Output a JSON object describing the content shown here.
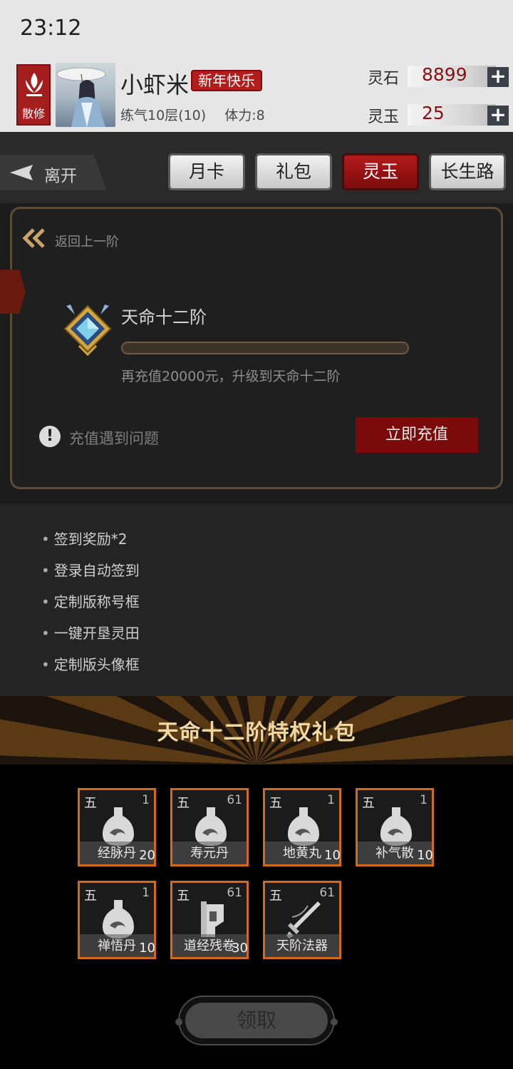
{
  "status_bar": {
    "time": "23:12"
  },
  "player": {
    "sect_label": "散修",
    "name": "小虾米",
    "title_badge": "新年快乐",
    "realm": "练气10层(10)",
    "stamina": "体力:8"
  },
  "resources": [
    {
      "label": "灵石",
      "value": "8899"
    },
    {
      "label": "灵玉",
      "value": "25"
    }
  ],
  "nav": {
    "leave_label": "离开",
    "tabs": [
      {
        "label": "月卡",
        "active": false
      },
      {
        "label": "礼包",
        "active": false
      },
      {
        "label": "灵玉",
        "active": true
      },
      {
        "label": "长生路",
        "active": false
      }
    ]
  },
  "panel": {
    "back_label": "返回上一阶",
    "rank_name": "天命十二阶",
    "progress": 0.0,
    "recharge_hint": "再充值20000元，升级到天命十二阶",
    "help_label": "充值遇到问题",
    "recharge_button": "立即充值"
  },
  "perks": [
    "签到奖励*2",
    "登录自动签到",
    "定制版称号框",
    "一键开垦灵田",
    "定制版头像框"
  ],
  "gift": {
    "title": "天命十二阶特权礼包",
    "items": [
      {
        "grade": "五",
        "level": "1",
        "name": "经脉丹",
        "qty": "20",
        "icon": "potion-icon"
      },
      {
        "grade": "五",
        "level": "61",
        "name": "寿元丹",
        "qty": "",
        "icon": "potion-icon"
      },
      {
        "grade": "五",
        "level": "1",
        "name": "地黄丸",
        "qty": "10",
        "icon": "potion-icon"
      },
      {
        "grade": "五",
        "level": "1",
        "name": "补气散",
        "qty": "10",
        "icon": "potion-icon"
      },
      {
        "grade": "五",
        "level": "1",
        "name": "禅悟丹",
        "qty": "10",
        "icon": "potion-icon"
      },
      {
        "grade": "五",
        "level": "61",
        "name": "道经残卷",
        "qty": "30",
        "icon": "scroll-icon"
      },
      {
        "grade": "五",
        "level": "61",
        "name": "天阶法器",
        "qty": "",
        "icon": "sword-icon"
      }
    ],
    "claim_label": "领取"
  },
  "colors": {
    "accent_red": "#7b0b0b",
    "item_border": "#d26a1d",
    "banner_text": "#f0d8a2"
  }
}
